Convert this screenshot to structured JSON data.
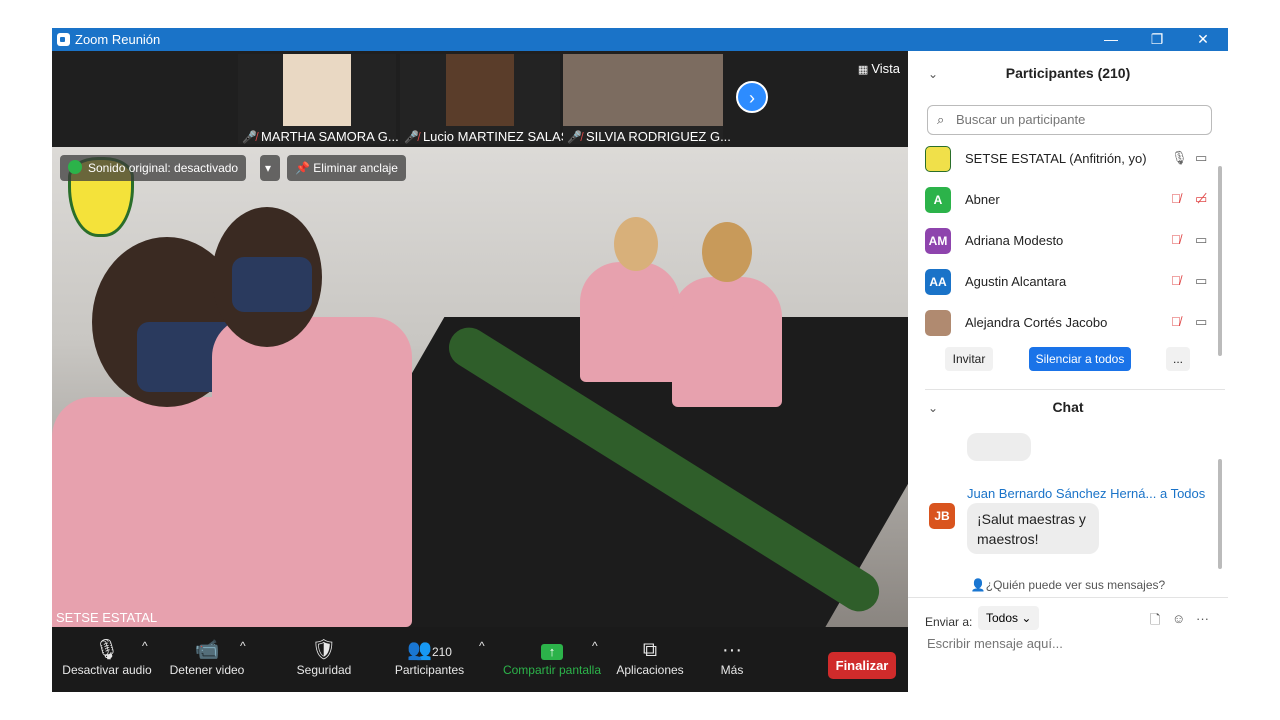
{
  "window": {
    "title": "Zoom Reunión",
    "controls": [
      "—",
      "❐",
      "✕"
    ]
  },
  "gallery": {
    "thumbnails": [
      {
        "name": "MARTHA SAMORA G...",
        "bg": "#e9d8c3"
      },
      {
        "name": "Lucio MARTINEZ SALAS",
        "bg": "#5a3d2a"
      },
      {
        "name": "SILVIA RODRIGUEZ G...",
        "bg": "#7c6c60"
      }
    ],
    "view_label": "Vista",
    "next_icon": "chevron-right-icon"
  },
  "video": {
    "sound_original": "Sonido original: desactivado",
    "unpin": "Eliminar anclaje",
    "self_name": "SETSE ESTATAL"
  },
  "toolbar": {
    "mute_audio": "Desactivar audio",
    "stop_video": "Detener video",
    "security": "Seguridad",
    "participants": "Participantes",
    "participants_count": "210",
    "share_screen": "Compartir pantalla",
    "apps": "Aplicaciones",
    "more": "Más",
    "end": "Finalizar",
    "colors": {
      "share": "#2cb34a",
      "end": "#d02b2b"
    }
  },
  "participants_panel": {
    "header": "Participantes (210)",
    "search_placeholder": "Buscar un participante",
    "list": [
      {
        "initials": "",
        "name": "SETSE ESTATAL (Anfitrión, yo)",
        "color": "#f0e04a",
        "muted": false,
        "cam_off": false
      },
      {
        "initials": "A",
        "name": "Abner",
        "color": "#2cb34a",
        "muted": true,
        "cam_off": true
      },
      {
        "initials": "AM",
        "name": "Adriana Modesto",
        "color": "#8e44ad",
        "muted": true,
        "cam_off": false
      },
      {
        "initials": "AA",
        "name": "Agustin Alcantara",
        "color": "#1a73c8",
        "muted": true,
        "cam_off": false
      },
      {
        "initials": "",
        "name": "Alejandra Cortés Jacobo",
        "color": "#b08a70",
        "muted": true,
        "cam_off": false
      }
    ],
    "invite": "Invitar",
    "mute_all": "Silenciar a todos",
    "more": "..."
  },
  "chat": {
    "header": "Chat",
    "message": {
      "sender": "Juan Bernardo Sánchez Herná...",
      "to": "a Todos",
      "initials": "JB",
      "avatar_color": "#d9541e",
      "text_line1": "¡Salut maestras y",
      "text_line2": "maestros!"
    },
    "who_can_see": "¿Quién puede ver sus mensajes?",
    "send_to_label": "Enviar a:",
    "send_to_value": "Todos",
    "input_placeholder": "Escribir mensaje aquí..."
  }
}
